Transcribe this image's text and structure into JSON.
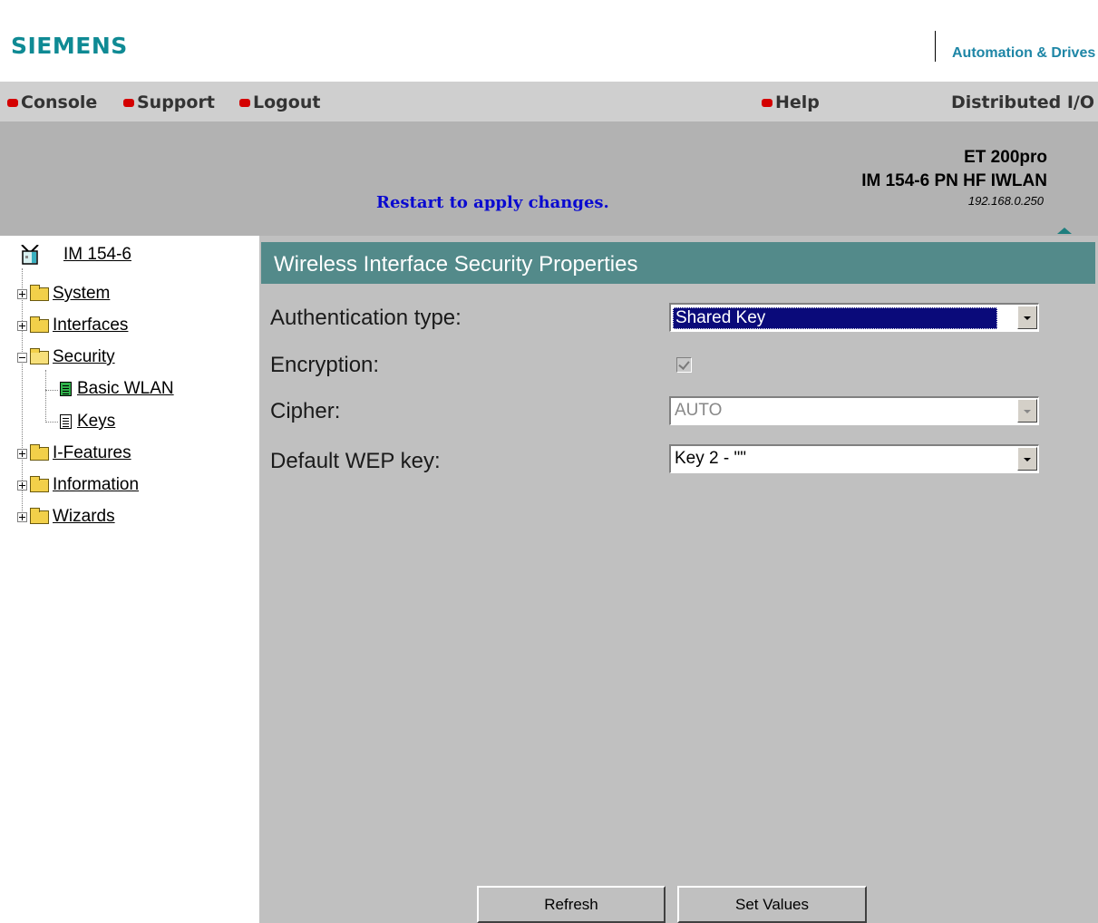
{
  "header": {
    "logo": "SIEMENS",
    "division": "Automation & Drives",
    "product_line": "Distributed I/O"
  },
  "nav": {
    "items": [
      {
        "label": "Console"
      },
      {
        "label": "Support"
      },
      {
        "label": "Logout"
      },
      {
        "label": "Help"
      }
    ]
  },
  "banner": {
    "restart_notice": "Restart to apply changes.",
    "device_name": "ET 200pro",
    "device_model": "IM 154-6 PN HF IWLAN",
    "ip_address": "192.168.0.250"
  },
  "tree": {
    "root": "IM 154-6",
    "items": [
      {
        "label": "System"
      },
      {
        "label": "Interfaces"
      },
      {
        "label": "Security"
      },
      {
        "label": "Basic WLAN"
      },
      {
        "label": "Keys"
      },
      {
        "label": "I-Features"
      },
      {
        "label": "Information"
      },
      {
        "label": "Wizards"
      }
    ]
  },
  "main": {
    "title": "Wireless Interface Security Properties",
    "fields": {
      "auth_label": "Authentication type:",
      "auth_value": "Shared Key",
      "encryption_label": "Encryption:",
      "encryption_checked": true,
      "cipher_label": "Cipher:",
      "cipher_value": "AUTO",
      "wep_label": "Default WEP key:",
      "wep_value": "Key 2 - \"\""
    },
    "buttons": {
      "refresh": "Refresh",
      "set_values": "Set Values"
    }
  },
  "colors": {
    "logo": "#0f8a94",
    "nav_bullet": "#d40000",
    "restart_notice": "#0a0ad0",
    "title_bar": "#538a8a",
    "content_bg": "#c0c0c0"
  }
}
